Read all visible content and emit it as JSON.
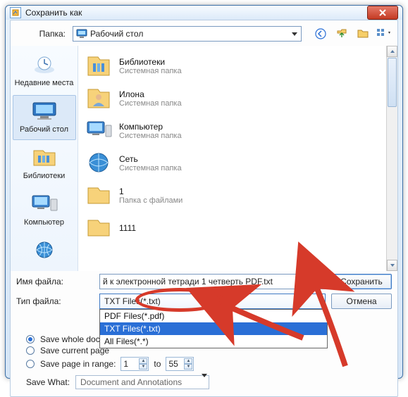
{
  "window": {
    "title": "Сохранить как"
  },
  "toolbar": {
    "folder_label": "Папка:",
    "current_folder": "Рабочий стол",
    "icons": [
      "back-icon",
      "up-icon",
      "new-folder-icon",
      "view-menu-icon"
    ]
  },
  "places": [
    {
      "label": "Недавние места",
      "icon": "recent"
    },
    {
      "label": "Рабочий стол",
      "icon": "desktop",
      "selected": true
    },
    {
      "label": "Библиотеки",
      "icon": "libraries"
    },
    {
      "label": "Компьютер",
      "icon": "computer"
    },
    {
      "label": "",
      "icon": "network"
    }
  ],
  "files": [
    {
      "name": "Библиотеки",
      "sub": "Системная папка",
      "icon": "libraries"
    },
    {
      "name": "Илона",
      "sub": "Системная папка",
      "icon": "user"
    },
    {
      "name": "Компьютер",
      "sub": "Системная папка",
      "icon": "computer"
    },
    {
      "name": "Сеть",
      "sub": "Системная папка",
      "icon": "network"
    },
    {
      "name": "1",
      "sub": "Папка с файлами",
      "icon": "folder"
    },
    {
      "name": "1111",
      "sub": "",
      "icon": "folder"
    }
  ],
  "form": {
    "filename_label": "Имя файла:",
    "filename_value": "й к электронной тетради 1 четверть PDF.txt",
    "filetype_label": "Тип файла:",
    "filetype_value": "TXT Files(*.txt)",
    "save_button": "Сохранить",
    "cancel_button": "Отмена",
    "type_options": [
      "PDF Files(*.pdf)",
      "TXT Files(*.txt)",
      "All Files(*.*)"
    ],
    "type_options_display": [
      "PDF Files(*.pdf)",
      "TXT Files(*.txt)",
      "All Files(*.*)"
    ]
  },
  "save_scope": {
    "whole": "Save whole document",
    "current": "Save current page",
    "range": "Save page in range:",
    "from": "1",
    "to_label": "to",
    "to": "55"
  },
  "save_what": {
    "label": "Save What:",
    "value": "Document and Annotations"
  }
}
